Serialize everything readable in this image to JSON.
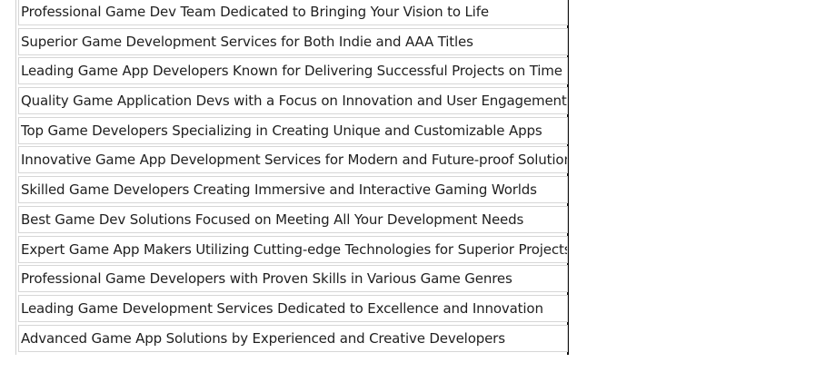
{
  "list": {
    "items": [
      "Professional Game Dev Team Dedicated to Bringing Your Vision to Life",
      "Superior Game Development Services for Both Indie and AAA Titles",
      "Leading Game App Developers Known for Delivering Successful Projects on Time",
      "Quality Game Application Devs with a Focus on Innovation and User Engagement",
      "Top Game Developers Specializing in Creating Unique and Customizable Apps",
      "Innovative Game App Development Services for Modern and Future-proof Solutions",
      "Skilled Game Developers Creating Immersive and Interactive Gaming Worlds",
      "Best Game Dev Solutions Focused on Meeting All Your Development Needs",
      "Expert Game App Makers Utilizing Cutting-edge Technologies for Superior Projects",
      "Professional Game Developers with Proven Skills in Various Game Genres",
      "Leading Game Development Services Dedicated to Excellence and Innovation",
      "Advanced Game App Solutions by Experienced and Creative Developers"
    ]
  }
}
